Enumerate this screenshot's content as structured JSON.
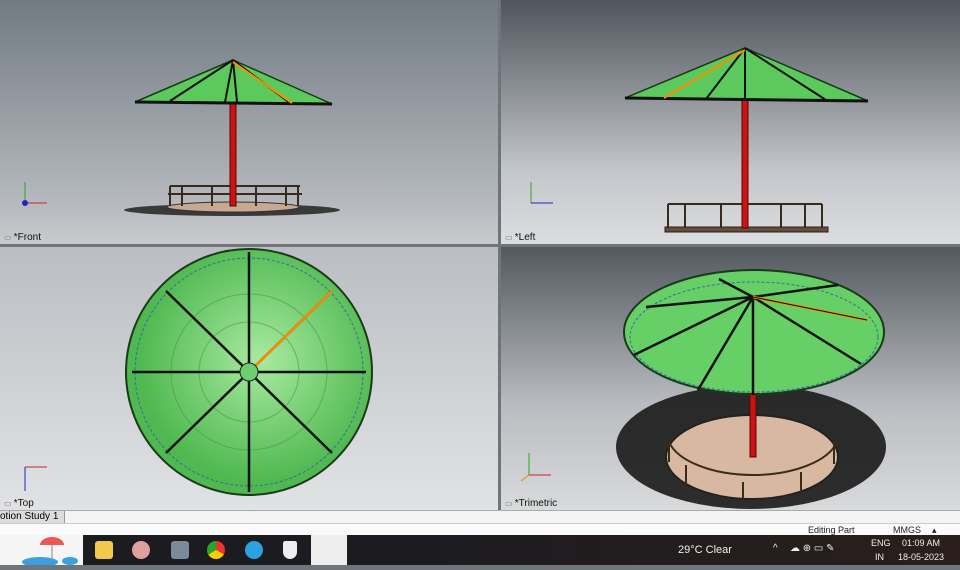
{
  "viewports": {
    "front": "*Front",
    "left": "*Left",
    "top": "*Top",
    "trimetric": "*Trimetric"
  },
  "tabs": {
    "study": "otion Study 1"
  },
  "status": {
    "mode": "Editing Part",
    "units": "MMGS",
    "units_arrow": "▴"
  },
  "taskbar": {
    "weather": "29°C  Clear",
    "lang1": "ENG",
    "lang2": "IN",
    "time": "01:09 AM",
    "date": "18-05-2023",
    "tray_chevron": "^"
  },
  "colors": {
    "canopy": "#5cc95c",
    "pole": "#c81414",
    "base": "#d8b8a0",
    "spoke_highlight": "#ff8c00"
  }
}
